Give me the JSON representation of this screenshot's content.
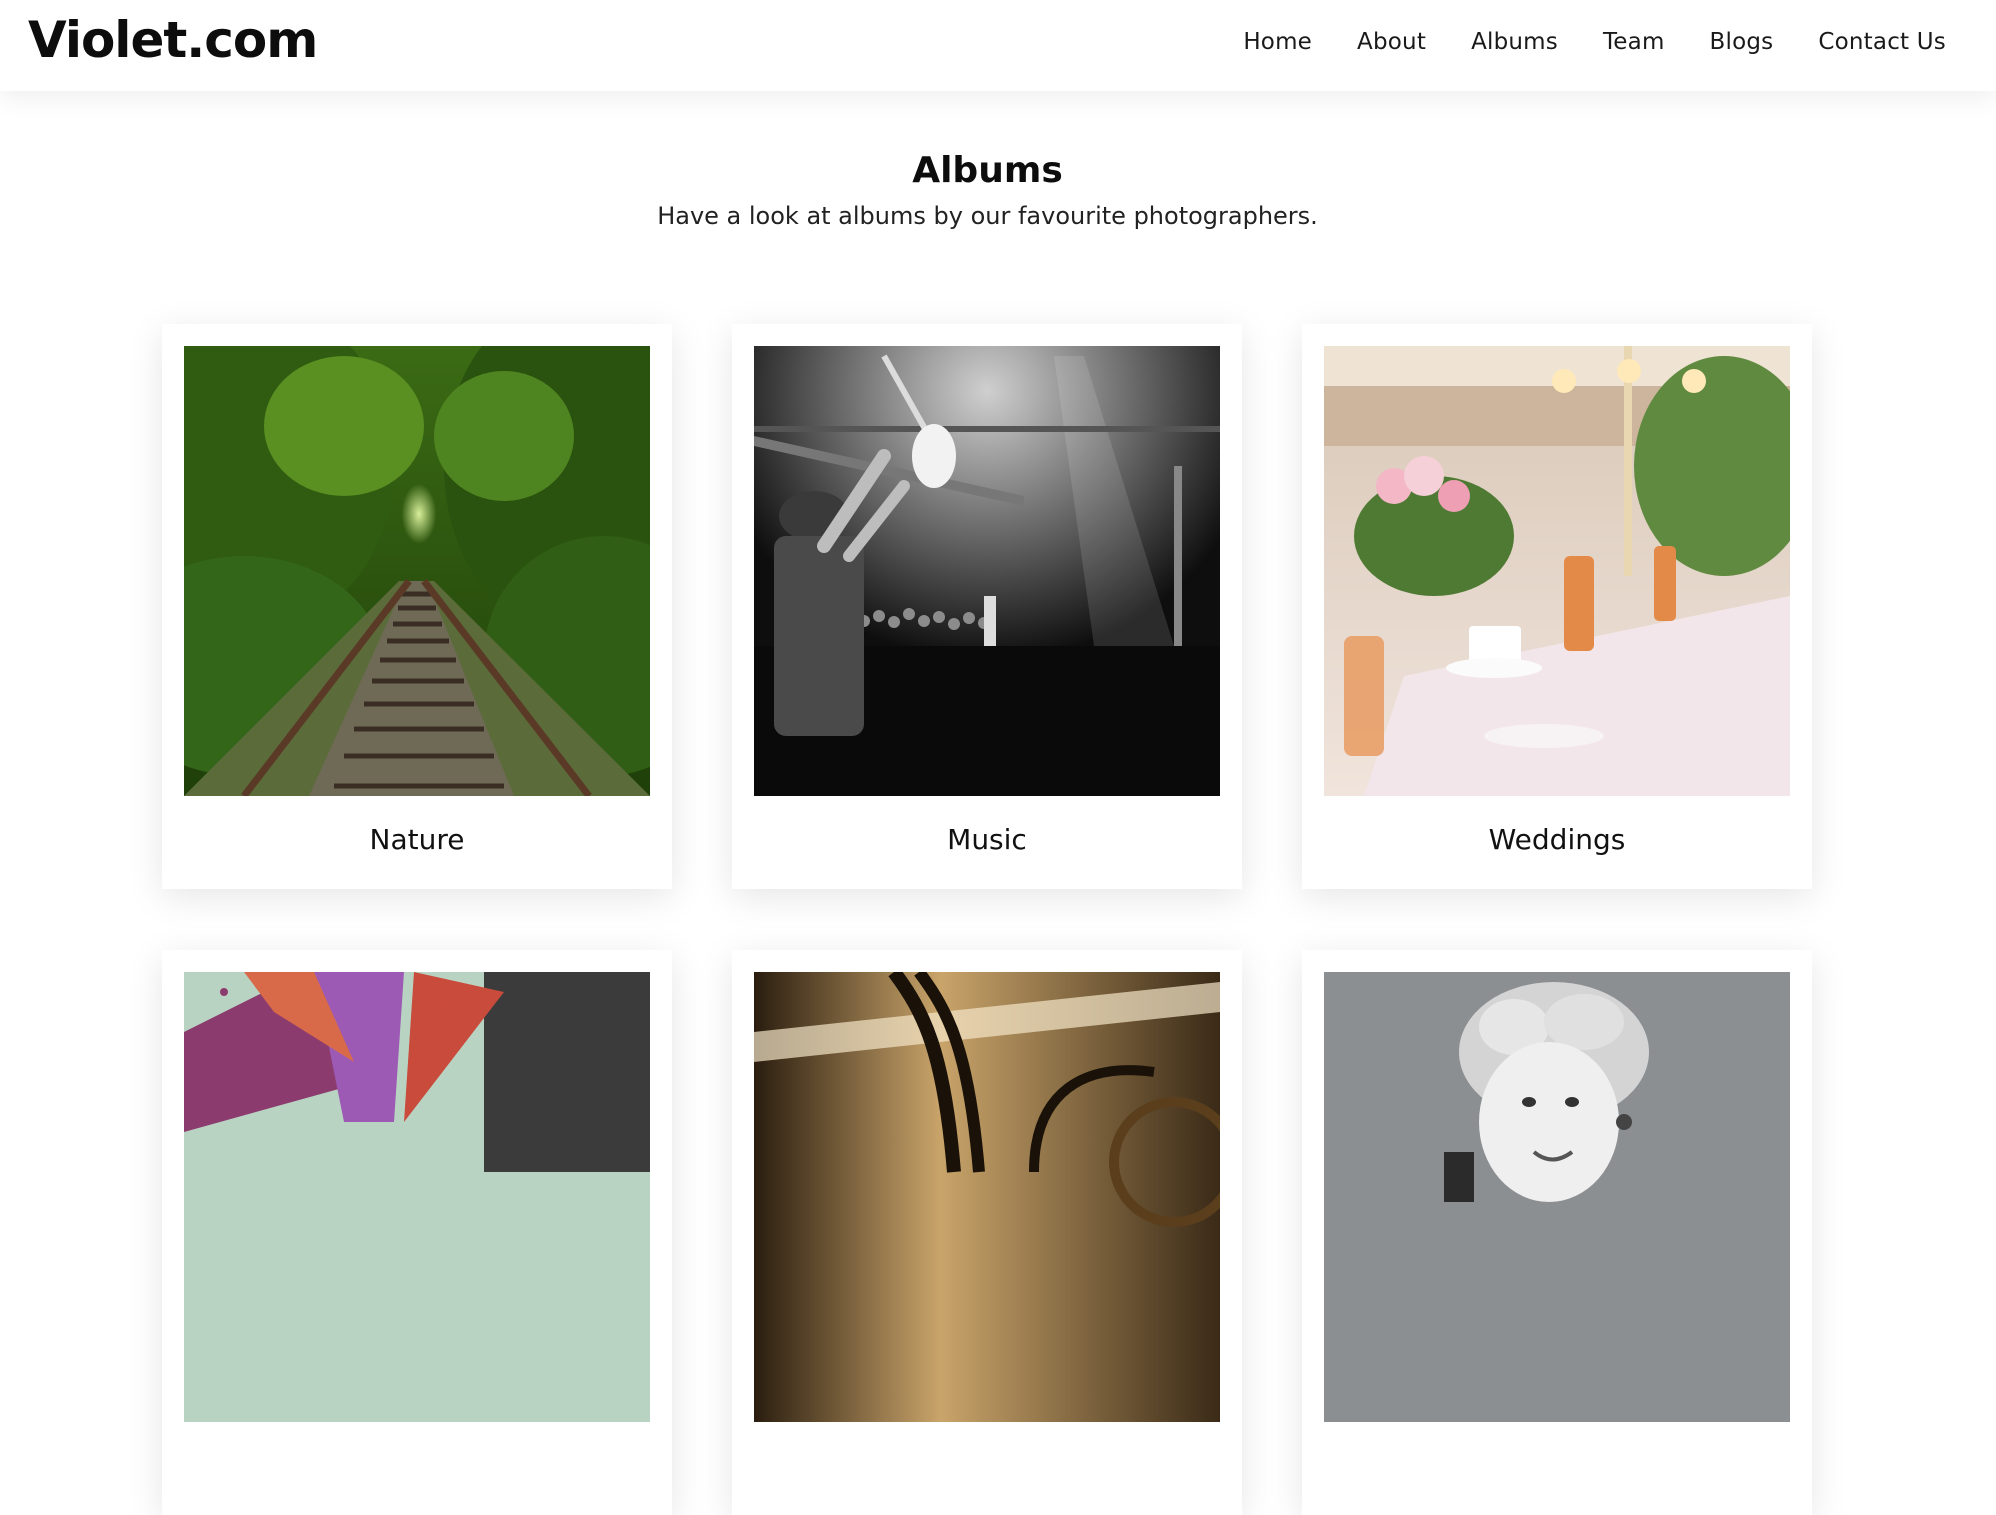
{
  "brand": {
    "name": "Violet.com"
  },
  "nav": [
    {
      "label": "Home"
    },
    {
      "label": "About"
    },
    {
      "label": "Albums"
    },
    {
      "label": "Team"
    },
    {
      "label": "Blogs"
    },
    {
      "label": "Contact Us"
    }
  ],
  "albums_section": {
    "title": "Albums",
    "subtitle": "Have a look at albums by our favourite photographers."
  },
  "albums": [
    {
      "label": "Nature",
      "photo": "railway-tracks-through-forest"
    },
    {
      "label": "Music",
      "photo": "concert-crowd-guitar-bw"
    },
    {
      "label": "Weddings",
      "photo": "wedding-table-setting"
    },
    {
      "label": "",
      "photo": "color-splash"
    },
    {
      "label": "",
      "photo": "vintage-car-detail"
    },
    {
      "label": "",
      "photo": "retro-woman-portrait-bw"
    }
  ],
  "colors": {
    "background": "#ffffff",
    "text": "#111111",
    "card": "#ffffff"
  }
}
